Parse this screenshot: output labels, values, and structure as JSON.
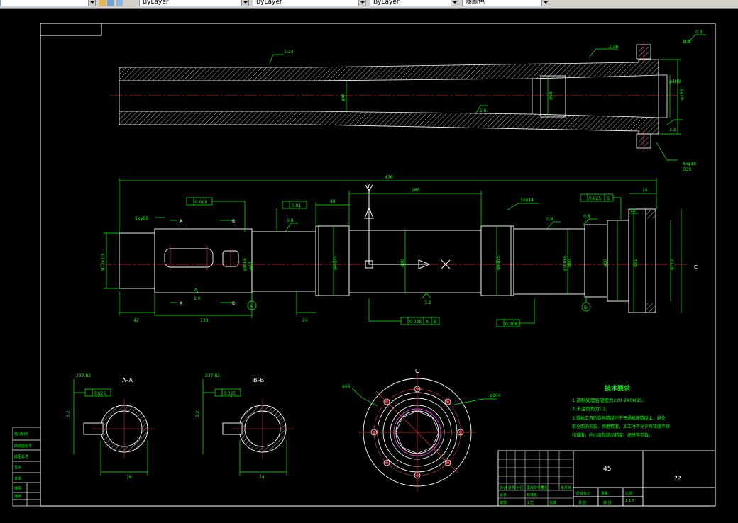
{
  "toolbar": {
    "layer_color": "ByLayer",
    "layer_linetype": "ByLayer",
    "layer_lineweight": "ByLayer",
    "plot_style": "随颜色"
  },
  "drawing": {
    "dims": {
      "top_taper": "1:24",
      "top_taper2": "1:36",
      "top_d1": "φ56",
      "top_d2": "φ68",
      "top_d3": "φ165",
      "top_d4": "φ4H9",
      "top_rough1": "1.6",
      "top_rough2": "3.2",
      "top_rough3": "0.3",
      "top_other": "其余",
      "top_holes": "8xφ18",
      "top_holes_note": "EQS",
      "len_total": "476",
      "len_165": "165",
      "len_48": "48",
      "len_42": "42",
      "len_133": "133",
      "len_24": "24",
      "len_19": "19",
      "len_15": "15",
      "thread": "M72x1.5",
      "key": "5xφ66",
      "d_80": "φ80js5",
      "d_90": "φ90",
      "d_80b": "φ80js5",
      "d_s1": "φ68",
      "d_s2": "φ60",
      "d_s3": "φ80",
      "d_s4": "φ91",
      "d_s5": "φ112",
      "d_j6": "φ80k6",
      "d_j7": "φ100k6",
      "tol_runout1": "0.008",
      "tol_cyl": "0.01",
      "tol_runout2": "0.025",
      "tol_runout3": "0.025",
      "tol_runout4": "0.008",
      "datum_a": "A",
      "datum_b": "B",
      "datum_ab": "A",
      "datum_ab2": "B",
      "rough_08a": "0.8",
      "rough_08b": "0.8",
      "rough_08c": "0.8",
      "rough_16": "1.6",
      "rough_32": "3.2",
      "note_ccs": "3xφ14",
      "axis_y": "Y",
      "axis_x": "X",
      "section_c": "C",
      "section_aa_mark": "A",
      "section_bb_mark": "B",
      "sec_aa_label": "A–A",
      "sec_bb_label": "B–B",
      "sec_aa_w": "76",
      "sec_bb_w": "74",
      "sec_aa_d": "237.82",
      "sec_bb_d": "237.82",
      "sec_aa_tol": "0.025",
      "sec_bb_tol": "0.025",
      "sec_aa_r1": "3.2",
      "sec_bb_r1": "3.2",
      "flange_label": "C",
      "flange_d1": "φ66",
      "flange_d2": "φ104"
    },
    "tech_req": {
      "title": "技术要求",
      "line1": "1.调制处理后硬度为220-240HBS;",
      "line2": "2.未注倒角为C2。",
      "line3": "3.锥轴工具的各种精度同于普通机床精度上，避免",
      "line4": "取全面的安装、修磨精度，加工时不允许有锥度不够",
      "line5": "和锥度，同心度及跳动精度，尾座等参数。"
    },
    "title_block": {
      "material": "45",
      "drawing_name": "??",
      "scale": "1:1.5",
      "r1": "标记",
      "r2": "处数",
      "r3": "分区",
      "r4": "更改文件号",
      "r5": "签名",
      "r6": "年月日",
      "r7": "设计",
      "r8": "标准化",
      "r9": "审核",
      "r10": "工艺",
      "r11": "批准",
      "r12": "阶段标记",
      "r13": "重量",
      "r14": "比例",
      "r15": "共 张",
      "r16": "第 张"
    },
    "side_table": {
      "c1": "借(通)用",
      "c2": "旧底图总号",
      "c3": "底图总号",
      "c4": "签字",
      "c5": "日期",
      "c6": "描图",
      "c7": "描校"
    }
  }
}
